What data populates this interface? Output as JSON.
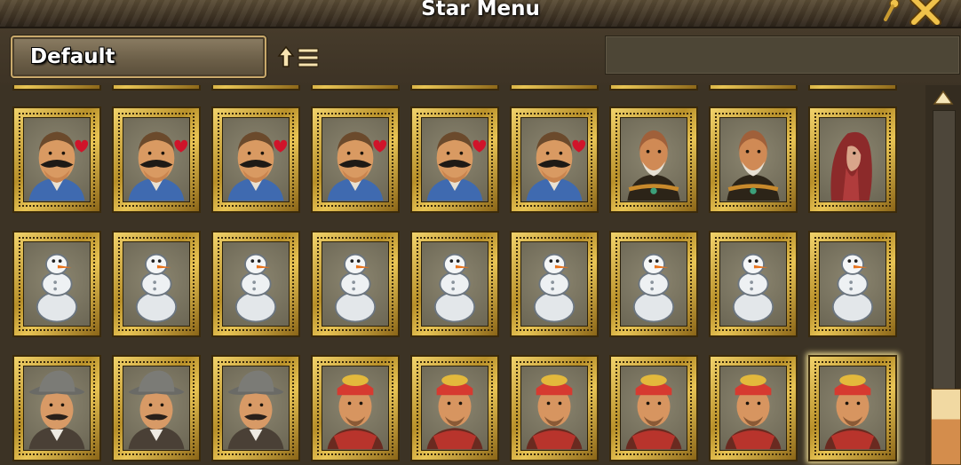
{
  "window": {
    "title": "Star Menu"
  },
  "toolbar": {
    "filter_selected": "Default",
    "sort_icon": "sort-ascending-icon",
    "search_value": "",
    "search_placeholder": ""
  },
  "icons": {
    "pin": "pin-icon",
    "close": "close-icon",
    "scroll_up": "scroll-up-arrow-icon"
  },
  "grid": {
    "rows": [
      [
        "dockworker",
        "dockworker",
        "dockworker",
        "dockworker",
        "dockworker",
        "dockworker",
        "bearded-general",
        "bearded-general",
        "red-cloaked-figure"
      ],
      [
        "snowman",
        "snowman",
        "snowman",
        "snowman",
        "snowman",
        "snowman",
        "snowman",
        "snowman",
        "snowman"
      ],
      [
        "hat-merchant",
        "hat-merchant",
        "hat-merchant",
        "bandana-adventurer",
        "bandana-adventurer",
        "bandana-adventurer",
        "bandana-adventurer",
        "bandana-adventurer",
        "bandana-adventurer"
      ]
    ],
    "highlighted": {
      "row": 2,
      "col": 8
    }
  },
  "colors": {
    "frame_gold": "#d9b246",
    "title_text": "#ffffff",
    "background": "#3c3325",
    "scroll_thumb": "#d48d4c"
  }
}
